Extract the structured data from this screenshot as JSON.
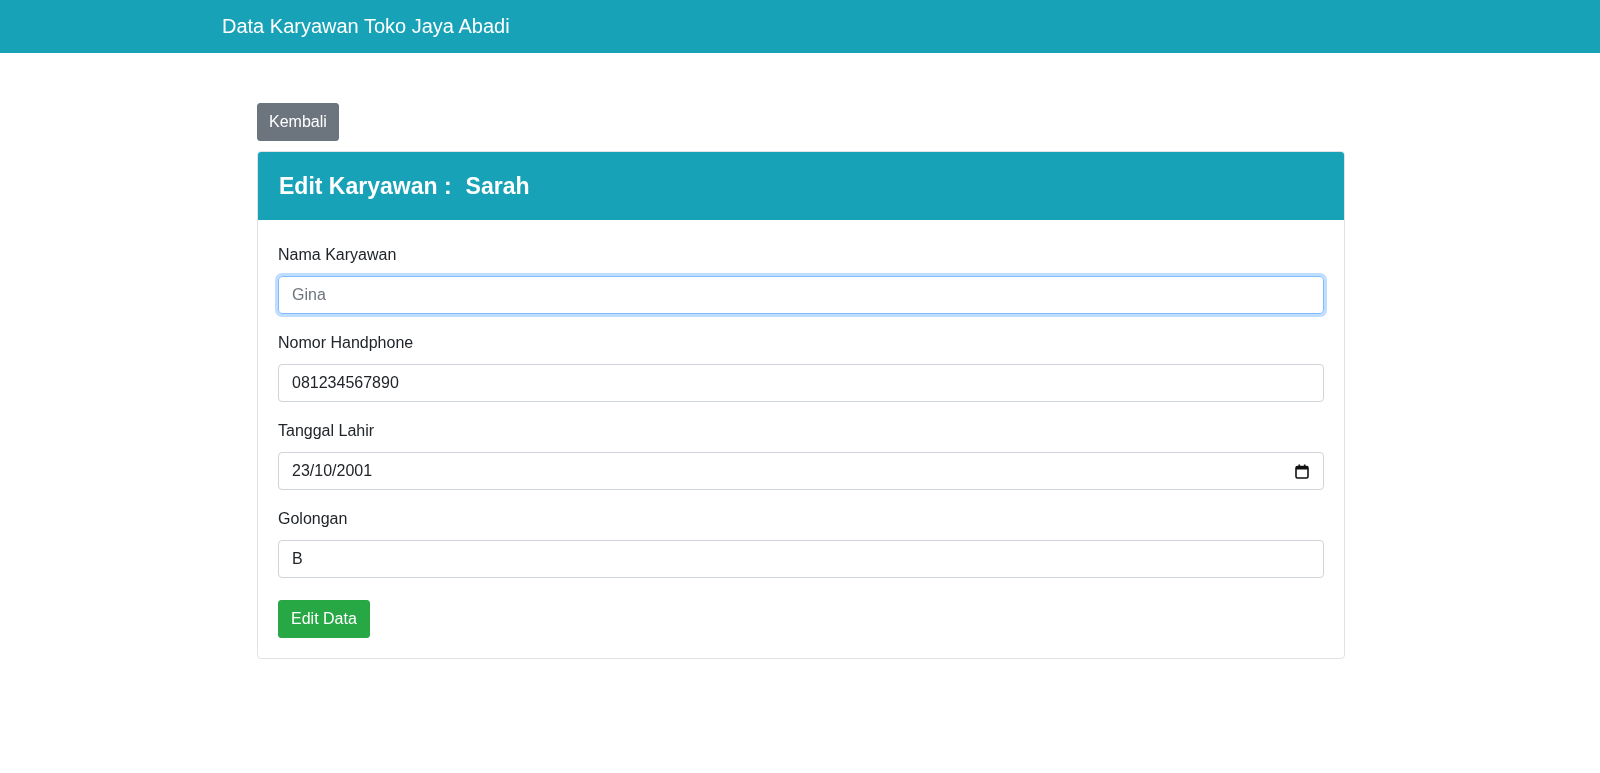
{
  "navbar": {
    "brand": "Data Karyawan Toko Jaya Abadi"
  },
  "back_button": "Kembali",
  "card": {
    "title": "Edit Karyawan :",
    "name": "Sarah",
    "fields": [
      {
        "label": "Nama Karyawan",
        "kind": "text",
        "placeholder": "Gina",
        "focused": true
      },
      {
        "label": "Nomor Handphone",
        "kind": "text",
        "value": "081234567890",
        "focused": false
      },
      {
        "label": "Tanggal Lahir",
        "kind": "date",
        "value": "23/10/2001",
        "focused": false
      },
      {
        "label": "Golongan",
        "kind": "text",
        "value": "B",
        "focused": false
      }
    ],
    "submit_button": "Edit Data"
  }
}
